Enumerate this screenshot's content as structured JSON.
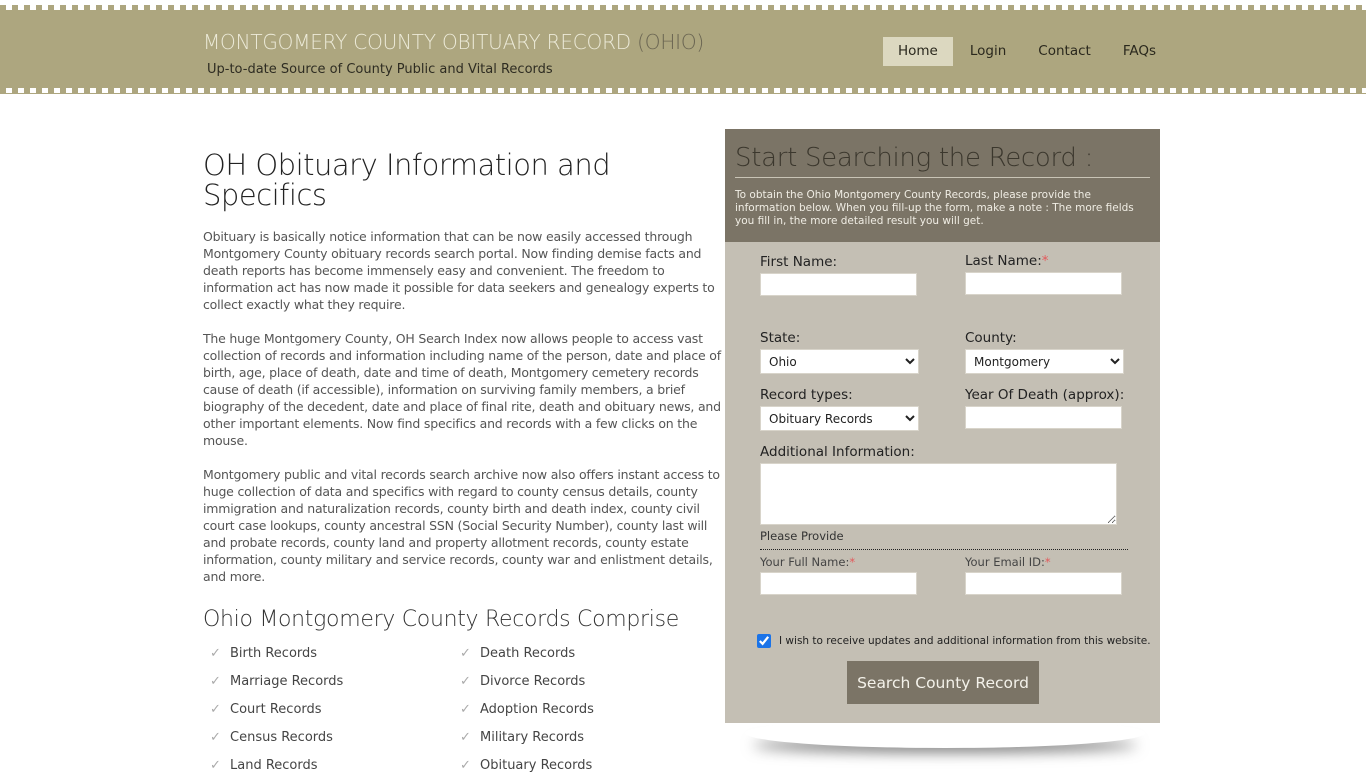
{
  "header": {
    "title_main": "MONTGOMERY COUNTY OBITUARY RECORD",
    "title_state": "(OHIO)",
    "tagline": "Up-to-date Source of  County Public and Vital Records",
    "nav": [
      {
        "label": "Home",
        "active": true
      },
      {
        "label": "Login",
        "active": false
      },
      {
        "label": "Contact",
        "active": false
      },
      {
        "label": "FAQs",
        "active": false
      }
    ]
  },
  "content": {
    "title": "OH Obituary Information and Specifics",
    "paragraphs": [
      "Obituary is basically notice information that can be now easily accessed through Montgomery County obituary records search portal. Now finding demise facts and death reports has become immensely easy and convenient. The freedom to information act has now made it possible for data seekers and genealogy experts to collect exactly what they require.",
      "The huge Montgomery County, OH Search Index now allows people to access vast collection of records and information including name of the person, date and place of birth, age, place of death, date and time of death, Montgomery cemetery records cause of death (if accessible), information on surviving family members, a brief biography of the decedent, date and place of final rite, death and obituary news, and other important elements. Now find specifics and records with a few clicks on the mouse.",
      "Montgomery public and vital records search archive now also offers instant access to huge collection of data and specifics with regard to county census details, county immigration and naturalization records, county birth and death index, county civil court case lookups, county ancestral SSN (Social Security Number), county last will and probate records, county land and property allotment records, county estate information, county military and service records, county war and enlistment details, and more."
    ],
    "records_title": "Ohio Montgomery County Records Comprise",
    "records": [
      "Birth Records",
      "Death Records",
      "Marriage Records",
      "Divorce Records",
      "Court Records",
      "Adoption Records",
      "Census Records",
      "Military Records",
      "Land Records",
      "Obituary Records"
    ]
  },
  "search": {
    "title": "Start Searching the Record :",
    "description": "To obtain the Ohio Montgomery County Records, please provide the information below. When you fill-up the form, make a note : The more fields you fill in, the more detailed result you will get.",
    "first_name_label": "First Name:",
    "first_name_value": "",
    "last_name_label": "Last Name:",
    "last_name_value": "",
    "required_mark": "*",
    "state_label": "State:",
    "state_value": "Ohio",
    "county_label": "County:",
    "county_value": "Montgomery",
    "record_types_label": "Record types:",
    "record_types_value": "Obituary Records",
    "year_label": "Year Of Death (approx):",
    "year_value": "",
    "additional_label": "Additional Information:",
    "additional_value": "",
    "provide_label": "Please Provide",
    "full_name_label": "Your Full Name:",
    "full_name_value": "",
    "email_label": "Your Email ID:",
    "email_value": "",
    "optin_label": "I wish to receive updates and additional information from this website.",
    "optin_checked": true,
    "submit_label": "Search County Record"
  }
}
